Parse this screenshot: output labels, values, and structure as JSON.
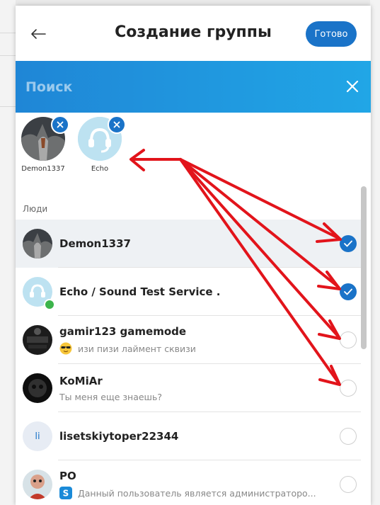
{
  "modal": {
    "title": "Создание группы",
    "done_label": "Готово"
  },
  "search": {
    "placeholder": "Поиск"
  },
  "selected": [
    {
      "label": "Demon1337"
    },
    {
      "label": "Echo"
    }
  ],
  "section_label": "Люди",
  "contacts": [
    {
      "name": "Demon1337",
      "status": "",
      "selected": true
    },
    {
      "name": "Echo / Sound Test Service .",
      "status": "",
      "selected": true,
      "online": true
    },
    {
      "name": "gamir123 gamemode",
      "status": "изи пизи лаймент сквизи",
      "selected": false
    },
    {
      "name": "KoMiAr",
      "status": "Ты меня еще знаешь?",
      "selected": false
    },
    {
      "name": "lisetskiytoper22344",
      "status": "",
      "selected": false,
      "initials": "li"
    },
    {
      "name": "PO",
      "status": "Данный пользователь является администраторо...",
      "selected": false
    }
  ],
  "colors": {
    "accent": "#1a73c8",
    "search_bar": "#21a6e6",
    "annotation": "#e2141b",
    "online": "#3cb44b"
  }
}
